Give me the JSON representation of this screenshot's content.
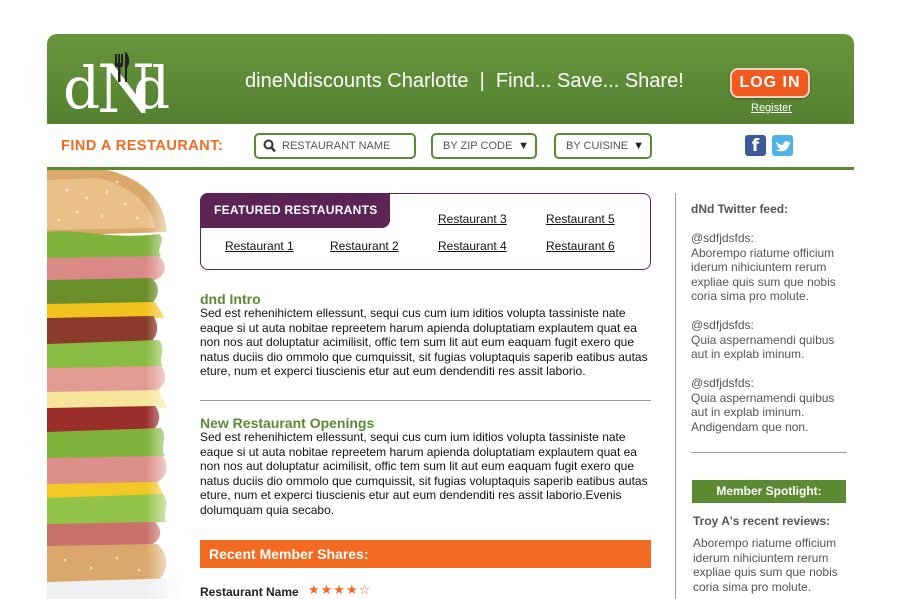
{
  "header": {
    "logo_text": "dNd",
    "tagline": "dineNdiscounts Charlotte  |  Find... Save... Share!",
    "login_label": "LOG IN",
    "register_label": "Register"
  },
  "search": {
    "label": "FIND A RESTAURANT:",
    "name_placeholder": "RESTAURANT NAME",
    "zip_label": "BY ZIP CODE",
    "cuisine_label": "BY CUISINE"
  },
  "social": {
    "facebook_glyph": "f"
  },
  "featured": {
    "tab_label": "FEATURED RESTAURANTS",
    "restaurants": [
      "Restaurant 1",
      "Restaurant 2",
      "Restaurant 3",
      "Restaurant 4",
      "Restaurant 5",
      "Restaurant 6"
    ]
  },
  "intro": {
    "title": "dnd Intro",
    "body": "Sed est rehenihictem ellessunt, sequi cus cum ium iditios volupta tassiniste nate eaque si ut auta nobitae repreetem harum apienda doluptatiam explautem quat ea non nos aut doluptatur acimilisit, offic tem sum lit aut eum eaquam fugit exero que natus duciis dio ommolo que cumquissit, sit fugias voluptaquis saperib eatibus autas eture, num et experci tiuscienis etur aut eum dendenditi res assit laborio."
  },
  "openings": {
    "title": "New Restaurant Openings",
    "body": "Sed est rehenihictem ellessunt, sequi cus cum ium iditios volupta tassiniste nate eaque si ut auta nobitae repreetem harum apienda doluptatiam explautem quat ea non nos aut doluptatur acimilisit, offic tem sum lit aut eum eaquam fugit exero que natus duciis dio ommolo que cumquissit, sit fugias voluptaquis saperib eatibus autas eture, num et experci tiuscienis etur aut eum dendenditi res assit laborio.Evenis dolumquam quia secabo."
  },
  "shares": {
    "title": "Recent Member Shares:",
    "restaurant_name": "Restaurant Name",
    "stars": "★★★★☆",
    "rating": 4,
    "rating_max": 5
  },
  "twitter": {
    "title": "dNd Twitter feed:",
    "tweets": [
      {
        "handle": "@sdfjdsfds:",
        "text": "Aborempo riatume officium iderum nihiciuntem rerum expliae quis sum que nobis coria sima pro molute."
      },
      {
        "handle": "@sdfjdsfds:",
        "text": "Quia aspernamendi quibus aut in explab iminum."
      },
      {
        "handle": "@sdfjdsfds:",
        "text": "Quia aspernamendi quibus aut in explab iminum. Andigendam que non."
      }
    ]
  },
  "spotlight": {
    "title": "Member Spotlight:",
    "review_title": "Troy A's recent reviews:",
    "review_text": "Aborempo riatume officium iderum nihiciuntem rerum expliae quis sum que nobis coria sima pro molute."
  },
  "colors": {
    "green": "#5b8a33",
    "orange": "#f26a21",
    "purple": "#5c2454"
  }
}
